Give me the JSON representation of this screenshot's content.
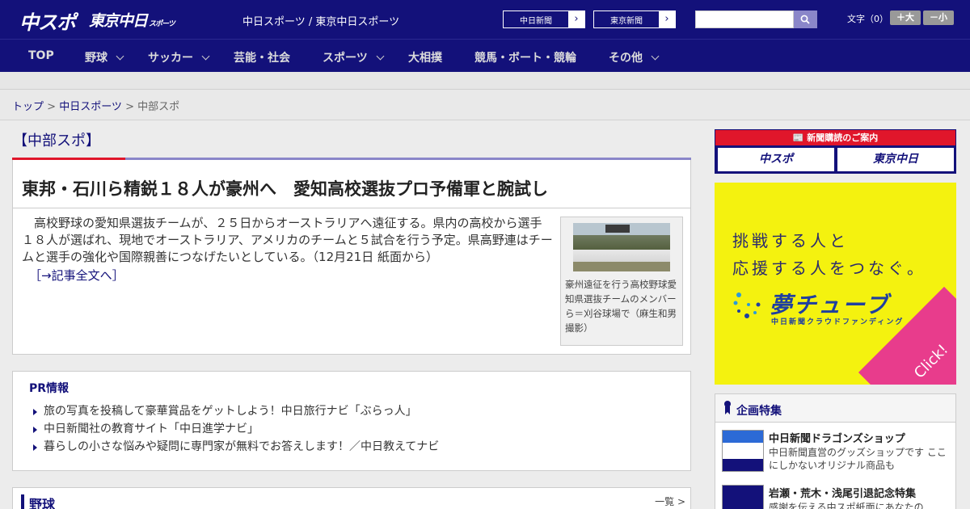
{
  "header": {
    "logo_chuspo": "中スポ",
    "logo_tokyo": "東京中日",
    "logo_tokyo_small": "スポーツ",
    "site_name": "中日スポーツ / 東京中日スポーツ",
    "paper_buttons": [
      "中日新聞",
      "東京新聞"
    ],
    "paper_arrow": "›",
    "search_placeholder": "",
    "font_size_label": "文字（0）",
    "font_plus": "＋大",
    "font_minus": "－小"
  },
  "nav": {
    "items": [
      {
        "label": "TOP",
        "dropdown": false
      },
      {
        "label": "野球",
        "dropdown": true
      },
      {
        "label": "サッカー",
        "dropdown": true
      },
      {
        "label": "芸能・社会",
        "dropdown": false
      },
      {
        "label": "スポーツ",
        "dropdown": true
      },
      {
        "label": "大相撲",
        "dropdown": false
      },
      {
        "label": "競馬・ボート・競輪",
        "dropdown": false
      },
      {
        "label": "その他",
        "dropdown": true
      }
    ]
  },
  "breadcrumb": {
    "top": "トップ",
    "sep": " > ",
    "section": "中日スポーツ",
    "current": "中部スポ"
  },
  "main": {
    "section_title": "【中部スポ】",
    "article": {
      "headline": "東邦・石川ら精鋭１８人が豪州へ　愛知高校選抜プロ予備軍と腕試し",
      "body": "高校野球の愛知県選抜チームが、２５日からオーストラリアへ遠征する。県内の高校から選手１８人が選ばれ、現地でオーストラリア、アメリカのチームと５試合を行う予定。県高野連はチームと選手の強化や国際親善につなげたいとしている。（12月21日 紙面から）",
      "more_link": "［→記事全文へ］",
      "photo_caption": "豪州遠征を行う高校野球愛知県選抜チームのメンバーら＝刈谷球場で（麻生和男撮影）"
    },
    "pr": {
      "title": "PR情報",
      "items": [
        "旅の写真を投稿して豪華賞品をゲットしよう！中日旅行ナビ「ぶらっ人」",
        "中日新聞社の教育サイト「中日進学ナビ」",
        "暮らしの小さな悩みや疑問に専門家が無料でお答えします！／中日教えてナビ"
      ]
    },
    "sport_bar": {
      "label": "野球",
      "list_link": "一覧 >"
    }
  },
  "sidebar": {
    "subscription": {
      "title": "新聞購読のご案内",
      "buttons": [
        "中スポ",
        "東京中日"
      ]
    },
    "ad": {
      "line1": "挑戦する人と",
      "line2": "応援する人をつなぐ。",
      "brand": "夢チューブ",
      "sub": "中日新聞クラウドファンディング",
      "click": "Click!"
    },
    "kikaku": {
      "title": "企画特集",
      "items": [
        {
          "title": "中日新聞ドラゴンズショップ",
          "desc": "中日新聞直営のグッズショップです ここにしかないオリジナル商品も"
        },
        {
          "title": "岩瀬・荒木・浅尾引退記念特集",
          "desc": "感謝を伝える中スポ紙面にあなたの"
        }
      ]
    }
  },
  "colors": {
    "brand_navy": "#13117a",
    "accent_red": "#e0162b",
    "ad_yellow": "#f4f20f",
    "ad_pink": "#e83c8c"
  }
}
